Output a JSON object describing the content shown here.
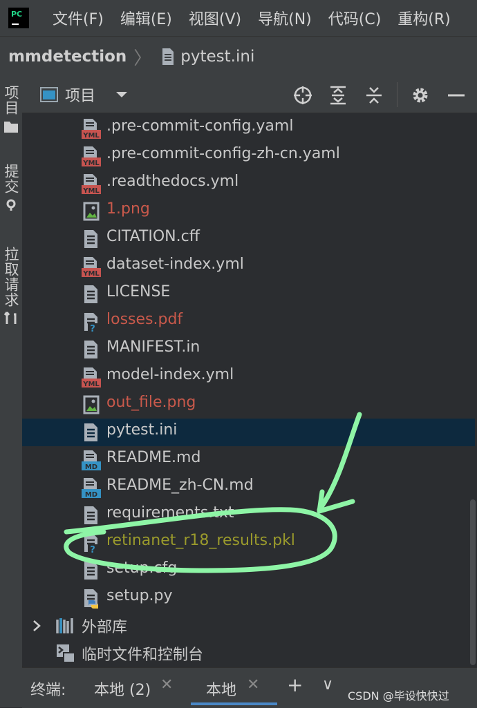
{
  "menubar": {
    "logo_text": "PC",
    "items": [
      "文件(F)",
      "编辑(E)",
      "视图(V)",
      "导航(N)",
      "代码(C)",
      "重构(R)"
    ]
  },
  "navbar": {
    "root": "mmdetection",
    "file": "pytest.ini"
  },
  "sidebar": {
    "tabs": [
      "项目",
      "提交",
      "拉取请求"
    ]
  },
  "panel": {
    "title": "项目"
  },
  "tree": {
    "files": [
      {
        "name": ".pre-commit-config.yaml",
        "icon": "yml-file-icon",
        "status": "normal"
      },
      {
        "name": ".pre-commit-config-zh-cn.yaml",
        "icon": "yml-file-icon",
        "status": "normal"
      },
      {
        "name": ".readthedocs.yml",
        "icon": "yml-file-icon",
        "status": "normal"
      },
      {
        "name": "1.png",
        "icon": "image-file-icon",
        "status": "untracked"
      },
      {
        "name": "CITATION.cff",
        "icon": "text-file-icon",
        "status": "normal"
      },
      {
        "name": "dataset-index.yml",
        "icon": "yml-file-icon",
        "status": "normal"
      },
      {
        "name": "LICENSE",
        "icon": "text-file-icon",
        "status": "normal"
      },
      {
        "name": "losses.pdf",
        "icon": "unknown-file-icon",
        "status": "untracked"
      },
      {
        "name": "MANIFEST.in",
        "icon": "text-file-icon",
        "status": "normal"
      },
      {
        "name": "model-index.yml",
        "icon": "yml-file-icon",
        "status": "normal"
      },
      {
        "name": "out_file.png",
        "icon": "image-file-icon",
        "status": "untracked"
      },
      {
        "name": "pytest.ini",
        "icon": "text-file-icon",
        "status": "selected"
      },
      {
        "name": "README.md",
        "icon": "md-file-icon",
        "status": "normal"
      },
      {
        "name": "README_zh-CN.md",
        "icon": "md-file-icon",
        "status": "normal"
      },
      {
        "name": "requirements.txt",
        "icon": "text-file-icon",
        "status": "normal"
      },
      {
        "name": "retinanet_r18_results.pkl",
        "icon": "unknown-file-icon",
        "status": "ignored"
      },
      {
        "name": "setup.cfg",
        "icon": "text-file-icon",
        "status": "normal"
      },
      {
        "name": "setup.py",
        "icon": "python-file-icon",
        "status": "normal"
      }
    ],
    "external_libs": "外部库",
    "scratches": "临时文件和控制台"
  },
  "colors": {
    "selected_row": "#0d293e",
    "untracked_text": "#c9594b",
    "ignored_text": "#9a9a2c",
    "annotation_stroke": "#8ef5a6"
  },
  "terminal": {
    "label": "终端:",
    "tabs": [
      "本地 (2)",
      "本地"
    ],
    "add": "+",
    "dropdown": "∨"
  },
  "watermark": "CSDN @毕设快快过"
}
